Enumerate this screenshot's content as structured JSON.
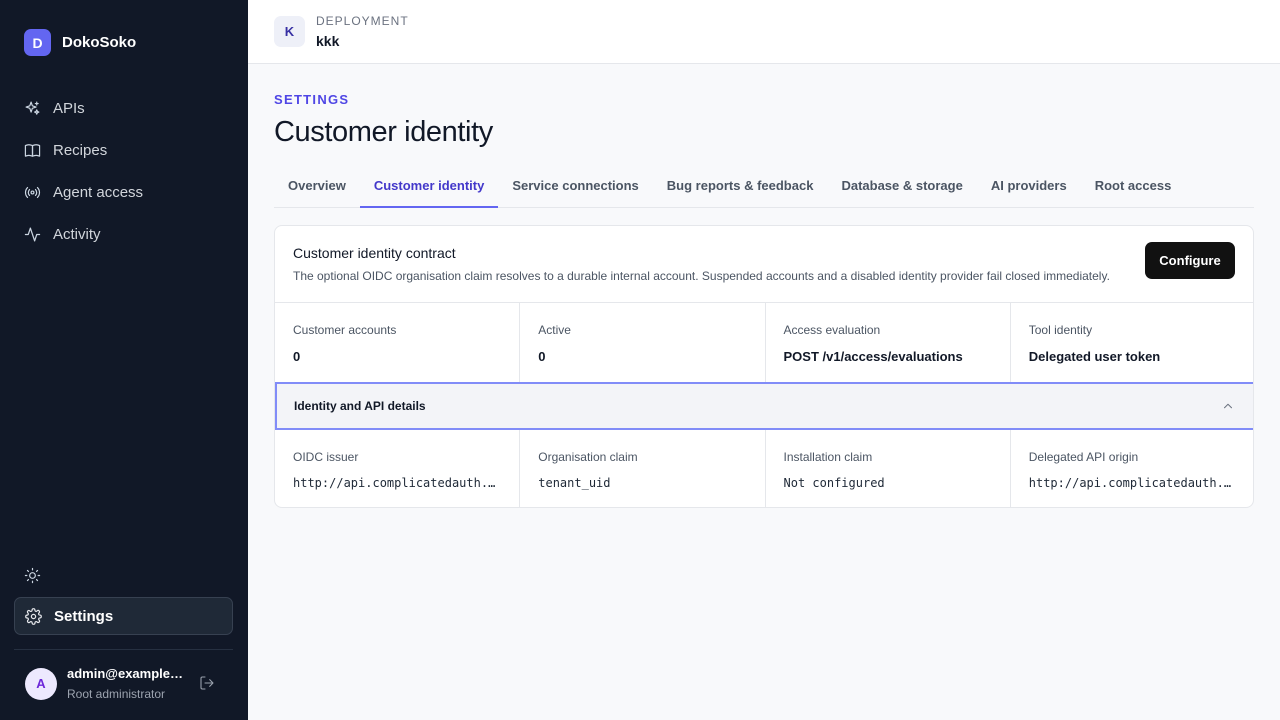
{
  "brand": {
    "initial": "D",
    "name": "DokoSoko"
  },
  "nav": [
    {
      "label": "APIs",
      "icon": "sparkles-icon"
    },
    {
      "label": "Recipes",
      "icon": "book-icon"
    },
    {
      "label": "Agent access",
      "icon": "broadcast-icon"
    },
    {
      "label": "Activity",
      "icon": "activity-icon"
    }
  ],
  "settings_label": "Settings",
  "user": {
    "initial": "A",
    "email": "admin@example.com",
    "role": "Root administrator"
  },
  "deployment": {
    "initial": "K",
    "label": "DEPLOYMENT",
    "name": "kkk"
  },
  "page": {
    "eyebrow": "SETTINGS",
    "title": "Customer identity"
  },
  "tabs": [
    {
      "label": "Overview",
      "active": false
    },
    {
      "label": "Customer identity",
      "active": true
    },
    {
      "label": "Service connections",
      "active": false
    },
    {
      "label": "Bug reports & feedback",
      "active": false
    },
    {
      "label": "Database & storage",
      "active": false
    },
    {
      "label": "AI providers",
      "active": false
    },
    {
      "label": "Root access",
      "active": false
    }
  ],
  "card": {
    "title": "Customer identity contract",
    "description": "The optional OIDC organisation claim resolves to a durable internal account. Suspended accounts and a disabled identity provider fail closed immediately.",
    "configure_label": "Configure",
    "stats": [
      {
        "label": "Customer accounts",
        "value": "0"
      },
      {
        "label": "Active",
        "value": "0"
      },
      {
        "label": "Access evaluation",
        "value": "POST /v1/access/evaluations"
      },
      {
        "label": "Tool identity",
        "value": "Delegated user token"
      }
    ],
    "accordion_title": "Identity and API details",
    "details": [
      {
        "label": "OIDC issuer",
        "value": "http://api.complicatedauth.example"
      },
      {
        "label": "Organisation claim",
        "value": "tenant_uid"
      },
      {
        "label": "Installation claim",
        "value": "Not configured"
      },
      {
        "label": "Delegated API origin",
        "value": "http://api.complicatedauth.example"
      }
    ]
  },
  "colors": {
    "sidebar": "#111827",
    "accent": "#4f46e5",
    "brand_badge": "#6366f1"
  }
}
